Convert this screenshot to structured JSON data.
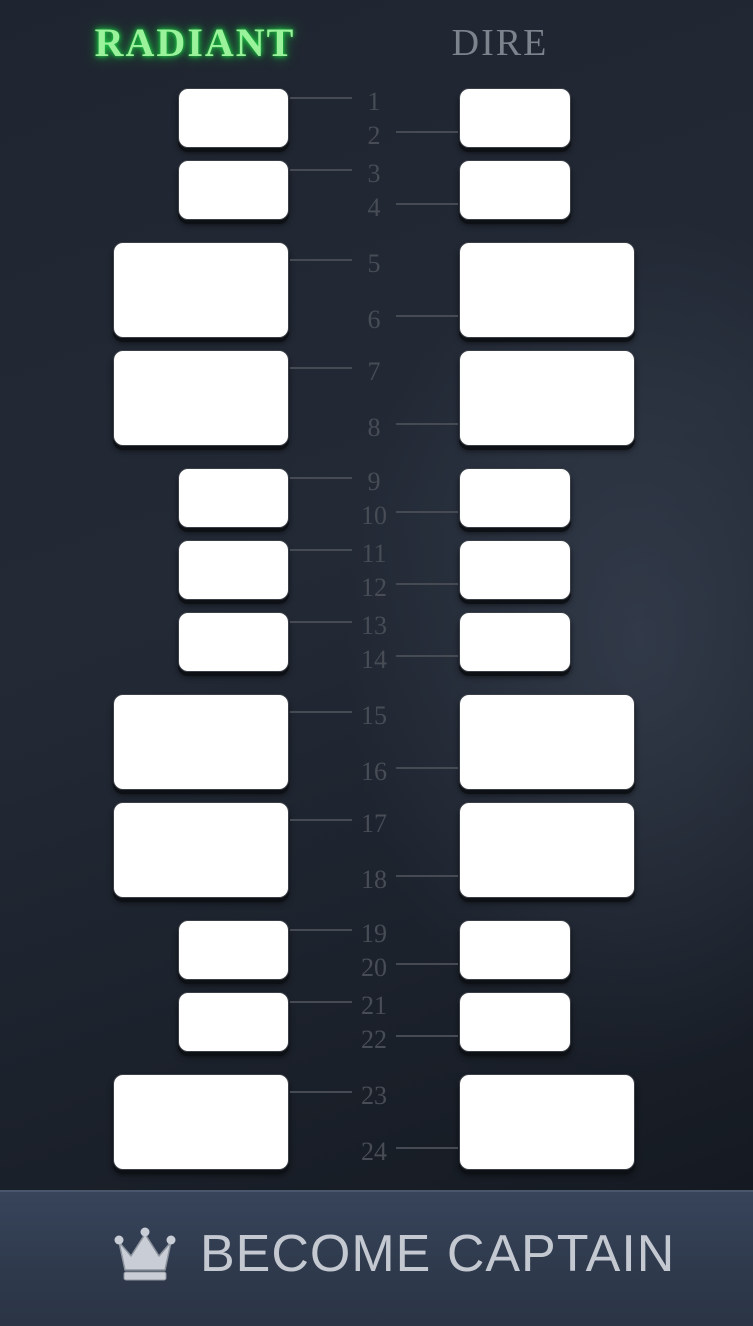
{
  "teams": {
    "radiant": "RADIANT",
    "dire": "DIRE"
  },
  "colors": {
    "radiant_glow": "#1fd84a",
    "dire_text": "#7d838d",
    "slot_fill": "#ffffff",
    "captain_bar": "#34405a"
  },
  "draft_slots": [
    {
      "label": "1"
    },
    {
      "label": "2"
    },
    {
      "label": "3"
    },
    {
      "label": "4"
    },
    {
      "label": "5"
    },
    {
      "label": "6"
    },
    {
      "label": "7"
    },
    {
      "label": "8"
    },
    {
      "label": "9"
    },
    {
      "label": "10"
    },
    {
      "label": "11"
    },
    {
      "label": "12"
    },
    {
      "label": "13"
    },
    {
      "label": "14"
    },
    {
      "label": "15"
    },
    {
      "label": "16"
    },
    {
      "label": "17"
    },
    {
      "label": "18"
    },
    {
      "label": "19"
    },
    {
      "label": "20"
    },
    {
      "label": "21"
    },
    {
      "label": "22"
    },
    {
      "label": "23"
    },
    {
      "label": "24"
    }
  ],
  "captain_button": {
    "label": "BECOME CAPTAIN",
    "icon": "crown-icon"
  }
}
